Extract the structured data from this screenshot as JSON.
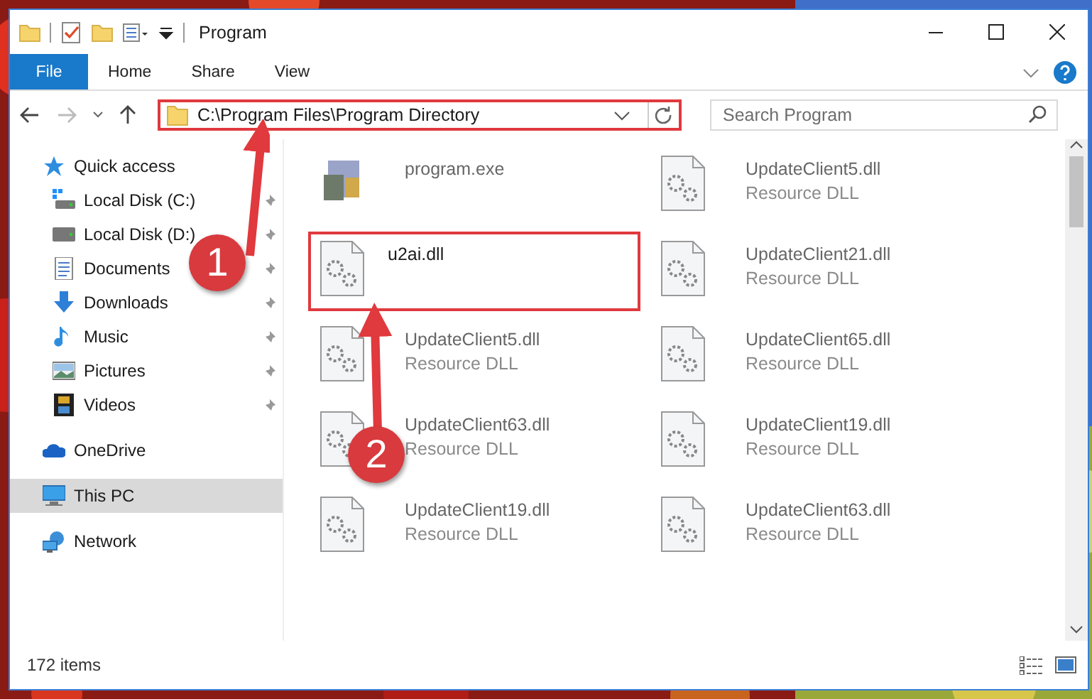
{
  "window": {
    "title": "Program"
  },
  "ribbon": {
    "tabs": [
      {
        "label": "File",
        "kind": "file",
        "selected": false
      },
      {
        "label": "Home",
        "kind": "tab",
        "selected": false
      },
      {
        "label": "Share",
        "kind": "tab",
        "selected": false
      },
      {
        "label": "View",
        "kind": "tab",
        "selected": false
      }
    ]
  },
  "address_bar": {
    "path": "C:\\Program Files\\Program Directory",
    "highlighted": true
  },
  "search": {
    "placeholder": "Search Program"
  },
  "sidebar": {
    "items": [
      {
        "label": "Quick access",
        "kind": "star",
        "selected": false,
        "children": [
          {
            "label": "Local Disk (C:)",
            "kind": "drive-c",
            "pinned": true,
            "selected": false
          },
          {
            "label": "Local Disk (D:)",
            "kind": "drive",
            "pinned": true,
            "selected": false
          },
          {
            "label": "Documents",
            "kind": "documents",
            "pinned": true,
            "selected": false
          },
          {
            "label": "Downloads",
            "kind": "downloads",
            "pinned": true,
            "selected": false
          },
          {
            "label": "Music",
            "kind": "music",
            "pinned": true,
            "selected": false
          },
          {
            "label": "Pictures",
            "kind": "pictures",
            "pinned": true,
            "selected": false
          },
          {
            "label": "Videos",
            "kind": "videos",
            "pinned": true,
            "selected": false
          }
        ]
      },
      {
        "label": "OneDrive",
        "kind": "cloud",
        "selected": false
      },
      {
        "label": "This PC",
        "kind": "pc",
        "selected": true
      },
      {
        "label": "Network",
        "kind": "network",
        "selected": false
      }
    ]
  },
  "files": [
    {
      "name": "program.exe",
      "kind": "exe",
      "highlighted": false
    },
    {
      "name": "UpdateClient5.dll",
      "type": "Resource DLL",
      "kind": "dll",
      "highlighted": false
    },
    {
      "name": "u2ai.dll",
      "kind": "dll",
      "highlighted": true
    },
    {
      "name": "UpdateClient21.dll",
      "type": "Resource DLL",
      "kind": "dll",
      "highlighted": false
    },
    {
      "name": "UpdateClient5.dll",
      "type": "Resource DLL",
      "kind": "dll",
      "highlighted": false
    },
    {
      "name": "UpdateClient65.dll",
      "type": "Resource DLL",
      "kind": "dll",
      "highlighted": false
    },
    {
      "name": "UpdateClient63.dll",
      "type": "Resource DLL",
      "kind": "dll",
      "highlighted": false
    },
    {
      "name": "UpdateClient19.dll",
      "type": "Resource DLL",
      "kind": "dll",
      "highlighted": false
    },
    {
      "name": "UpdateClient19.dll",
      "type": "Resource DLL",
      "kind": "dll",
      "highlighted": false
    },
    {
      "name": "UpdateClient63.dll",
      "type": "Resource DLL",
      "kind": "dll",
      "highlighted": false
    }
  ],
  "status_bar": {
    "text": "172 items"
  },
  "callouts": [
    {
      "number": "1"
    },
    {
      "number": "2"
    }
  ]
}
